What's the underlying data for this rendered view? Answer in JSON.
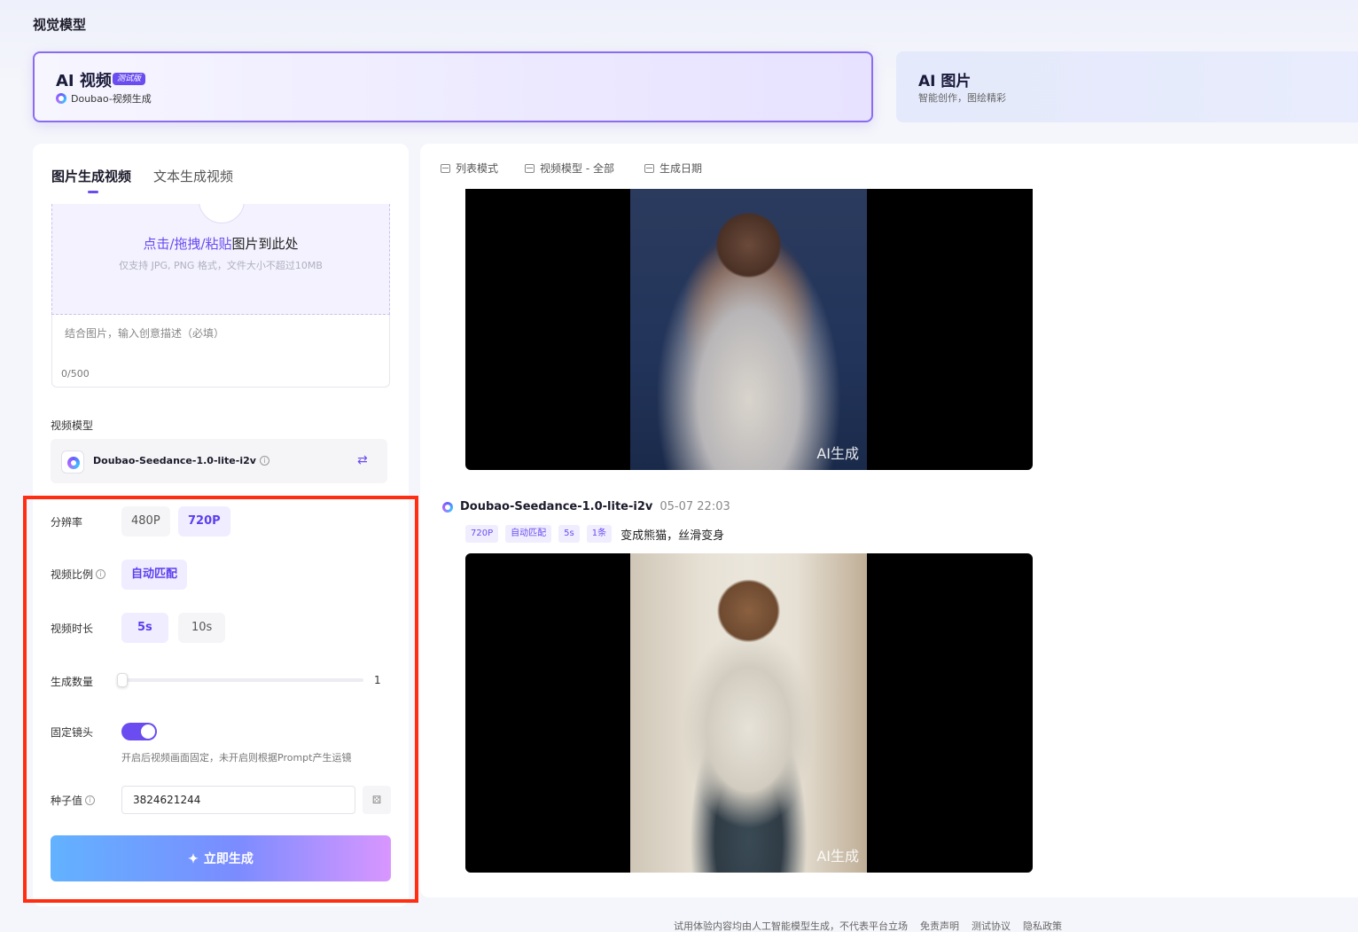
{
  "page": {
    "title": "视觉模型"
  },
  "cards": {
    "video": {
      "title": "AI 视频",
      "badge": "测试版",
      "subtitle": "Doubao-视频生成"
    },
    "image": {
      "title": "AI 图片",
      "subtitle": "智能创作，图绘精彩"
    }
  },
  "left": {
    "tabs": [
      {
        "label": "图片生成视频",
        "active": true
      },
      {
        "label": "文本生成视频",
        "active": false
      }
    ],
    "upload": {
      "highlight": "点击/拖拽/粘贴",
      "rest": "图片到此处",
      "hint": "仅支持 JPG, PNG 格式，文件大小不超过10MB"
    },
    "prompt": {
      "placeholder": "结合图片，输入创意描述（必填）",
      "count": "0/500"
    },
    "model": {
      "label": "视频模型",
      "name": "Doubao-Seedance-1.0-lite-i2v"
    },
    "resolution": {
      "label": "分辨率",
      "options": [
        "480P",
        "720P"
      ],
      "selected": "720P"
    },
    "ratio": {
      "label": "视频比例",
      "options": [
        "自动匹配"
      ],
      "selected": "自动匹配"
    },
    "duration": {
      "label": "视频时长",
      "options": [
        "5s",
        "10s"
      ],
      "selected": "5s"
    },
    "count": {
      "label": "生成数量",
      "value": "1"
    },
    "fixed_camera": {
      "label": "固定镜头",
      "enabled": true,
      "hint": "开启后视频画面固定，未开启则根据Prompt产生运镜"
    },
    "seed": {
      "label": "种子值",
      "value": "3824621244"
    },
    "generate_label": "立即生成"
  },
  "right": {
    "toolbar": [
      "列表模式",
      "视频模型 - 全部",
      "生成日期"
    ],
    "watermark": "AI生成",
    "record": {
      "model": "Doubao-Seedance-1.0-lite-i2v",
      "time": "05-07 22:03",
      "tags": [
        "720P",
        "自动匹配",
        "5s",
        "1条"
      ],
      "prompt": "变成熊猫，丝滑变身"
    }
  },
  "footer": {
    "disclaimer": "试用体验内容均由人工智能模型生成，不代表平台立场",
    "links": [
      "免责声明",
      "测试协议",
      "隐私政策"
    ]
  },
  "colors": {
    "accent": "#6a4cf0",
    "highlight": "#ff2d12"
  },
  "icons": {
    "info": "info-icon",
    "swap": "swap-icon",
    "dice": "dice-icon",
    "sparkle": "sparkle-icon",
    "list": "list-icon",
    "calendar": "calendar-icon"
  }
}
